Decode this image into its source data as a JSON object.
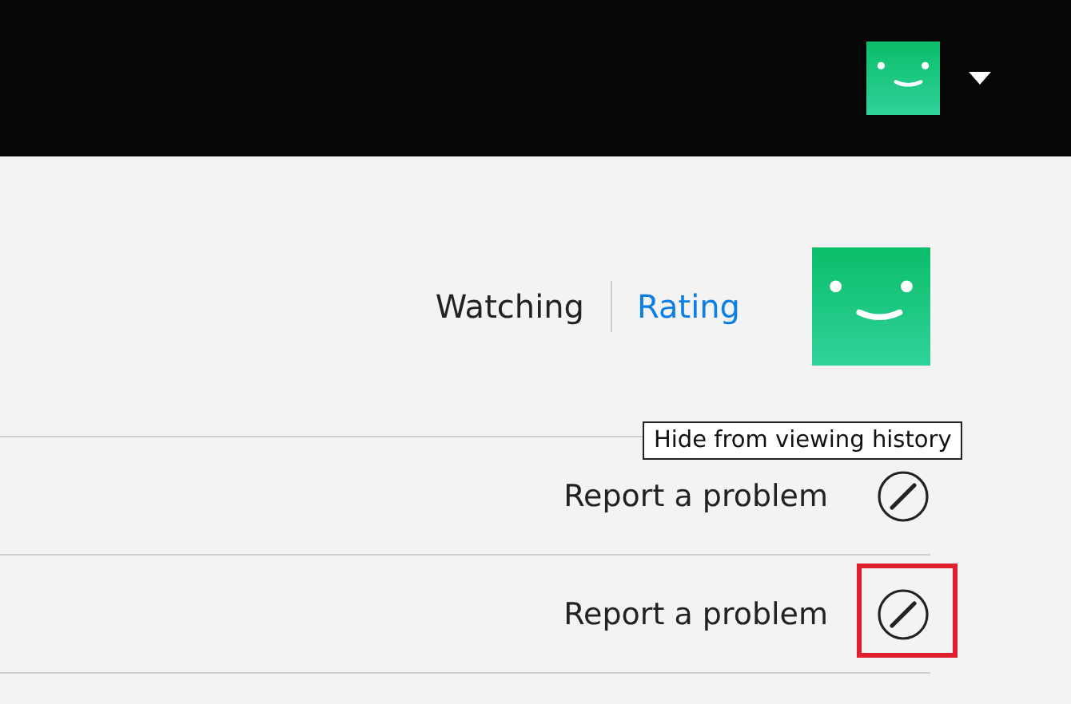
{
  "header": {
    "profile_menu": {
      "expanded": false
    }
  },
  "tabs": [
    {
      "label": "Watching",
      "selected": false
    },
    {
      "label": "Rating",
      "selected": true
    }
  ],
  "rows": [
    {
      "link": "Report a problem",
      "tooltip": "Hide from viewing history",
      "highlighted": false
    },
    {
      "link": "Report a problem",
      "highlighted": true
    }
  ]
}
